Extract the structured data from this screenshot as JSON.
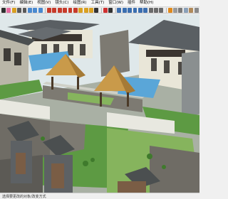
{
  "menu": {
    "items": [
      "文件(F)",
      "编辑(E)",
      "视图(V)",
      "镜头(C)",
      "绘图(R)",
      "工具(T)",
      "窗口(W)",
      "插件",
      "帮助(H)"
    ]
  },
  "toolbar": {
    "buttons": [
      {
        "icon": "select-arrow-icon",
        "color": "#2f2f2f"
      },
      {
        "icon": "eraser-icon",
        "color": "#e46aa0"
      },
      {
        "icon": "paint-bucket-icon",
        "color": "#d9a021"
      },
      {
        "icon": "line-pencil-icon",
        "color": "#5a5a5a"
      },
      {
        "icon": "arc-icon",
        "color": "#5a5a5a"
      },
      {
        "icon": "rectangle-icon",
        "color": "#4a8ad0"
      },
      {
        "icon": "circle-icon",
        "color": "#4a8ad0"
      },
      {
        "icon": "polygon-icon",
        "color": "#4a8ad0"
      },
      {
        "icon": "move-icon",
        "color": "#c73a2a"
      },
      {
        "icon": "push-pull-icon",
        "color": "#c73a2a"
      },
      {
        "icon": "rotate-icon",
        "color": "#c73a2a"
      },
      {
        "icon": "follow-me-icon",
        "color": "#c73a2a"
      },
      {
        "icon": "scale-icon",
        "color": "#c73a2a"
      },
      {
        "icon": "offset-icon",
        "color": "#c73a2a"
      },
      {
        "icon": "tape-measure-icon",
        "color": "#d9a021"
      },
      {
        "icon": "dimension-icon",
        "color": "#d9a021"
      },
      {
        "icon": "protractor-icon",
        "color": "#d9a021"
      },
      {
        "icon": "text-icon",
        "color": "#333333"
      },
      {
        "icon": "axes-icon",
        "color": "#d03030"
      },
      {
        "icon": "3d-text-icon",
        "color": "#333333"
      },
      {
        "icon": "orbit-icon",
        "color": "#3c6fb0"
      },
      {
        "icon": "pan-icon",
        "color": "#3c6fb0"
      },
      {
        "icon": "zoom-icon",
        "color": "#3c6fb0"
      },
      {
        "icon": "zoom-window-icon",
        "color": "#3c6fb0"
      },
      {
        "icon": "zoom-extents-icon",
        "color": "#3c6fb0"
      },
      {
        "icon": "previous-view-icon",
        "color": "#3c6fb0"
      },
      {
        "icon": "position-camera-icon",
        "color": "#6a6a6a"
      },
      {
        "icon": "walk-icon",
        "color": "#6a6a6a"
      },
      {
        "icon": "look-around-icon",
        "color": "#6a6a6a"
      },
      {
        "icon": "section-plane-icon",
        "color": "#e08a1c"
      },
      {
        "icon": "xray-icon",
        "color": "#9a9a9a"
      },
      {
        "icon": "wireframe-icon",
        "color": "#7a7a7a"
      },
      {
        "icon": "shaded-icon",
        "color": "#8aa0b8"
      },
      {
        "icon": "textured-icon",
        "color": "#b08a5a"
      },
      {
        "icon": "monochrome-icon",
        "color": "#8a8a8a"
      }
    ]
  },
  "status": {
    "text": "选择要更改的对象/改变方式"
  },
  "colors": {
    "wall_gray": "#8a8f90",
    "wall_dark": "#4b4f50",
    "stone": "#7d7a72",
    "roof_gold": "#c99a4a",
    "roof_dark": "#5a5f63",
    "lawn": "#5d9a43",
    "lawn_light": "#86b45d",
    "pool": "#5aa6d8",
    "facade": "#e9e6d8"
  }
}
